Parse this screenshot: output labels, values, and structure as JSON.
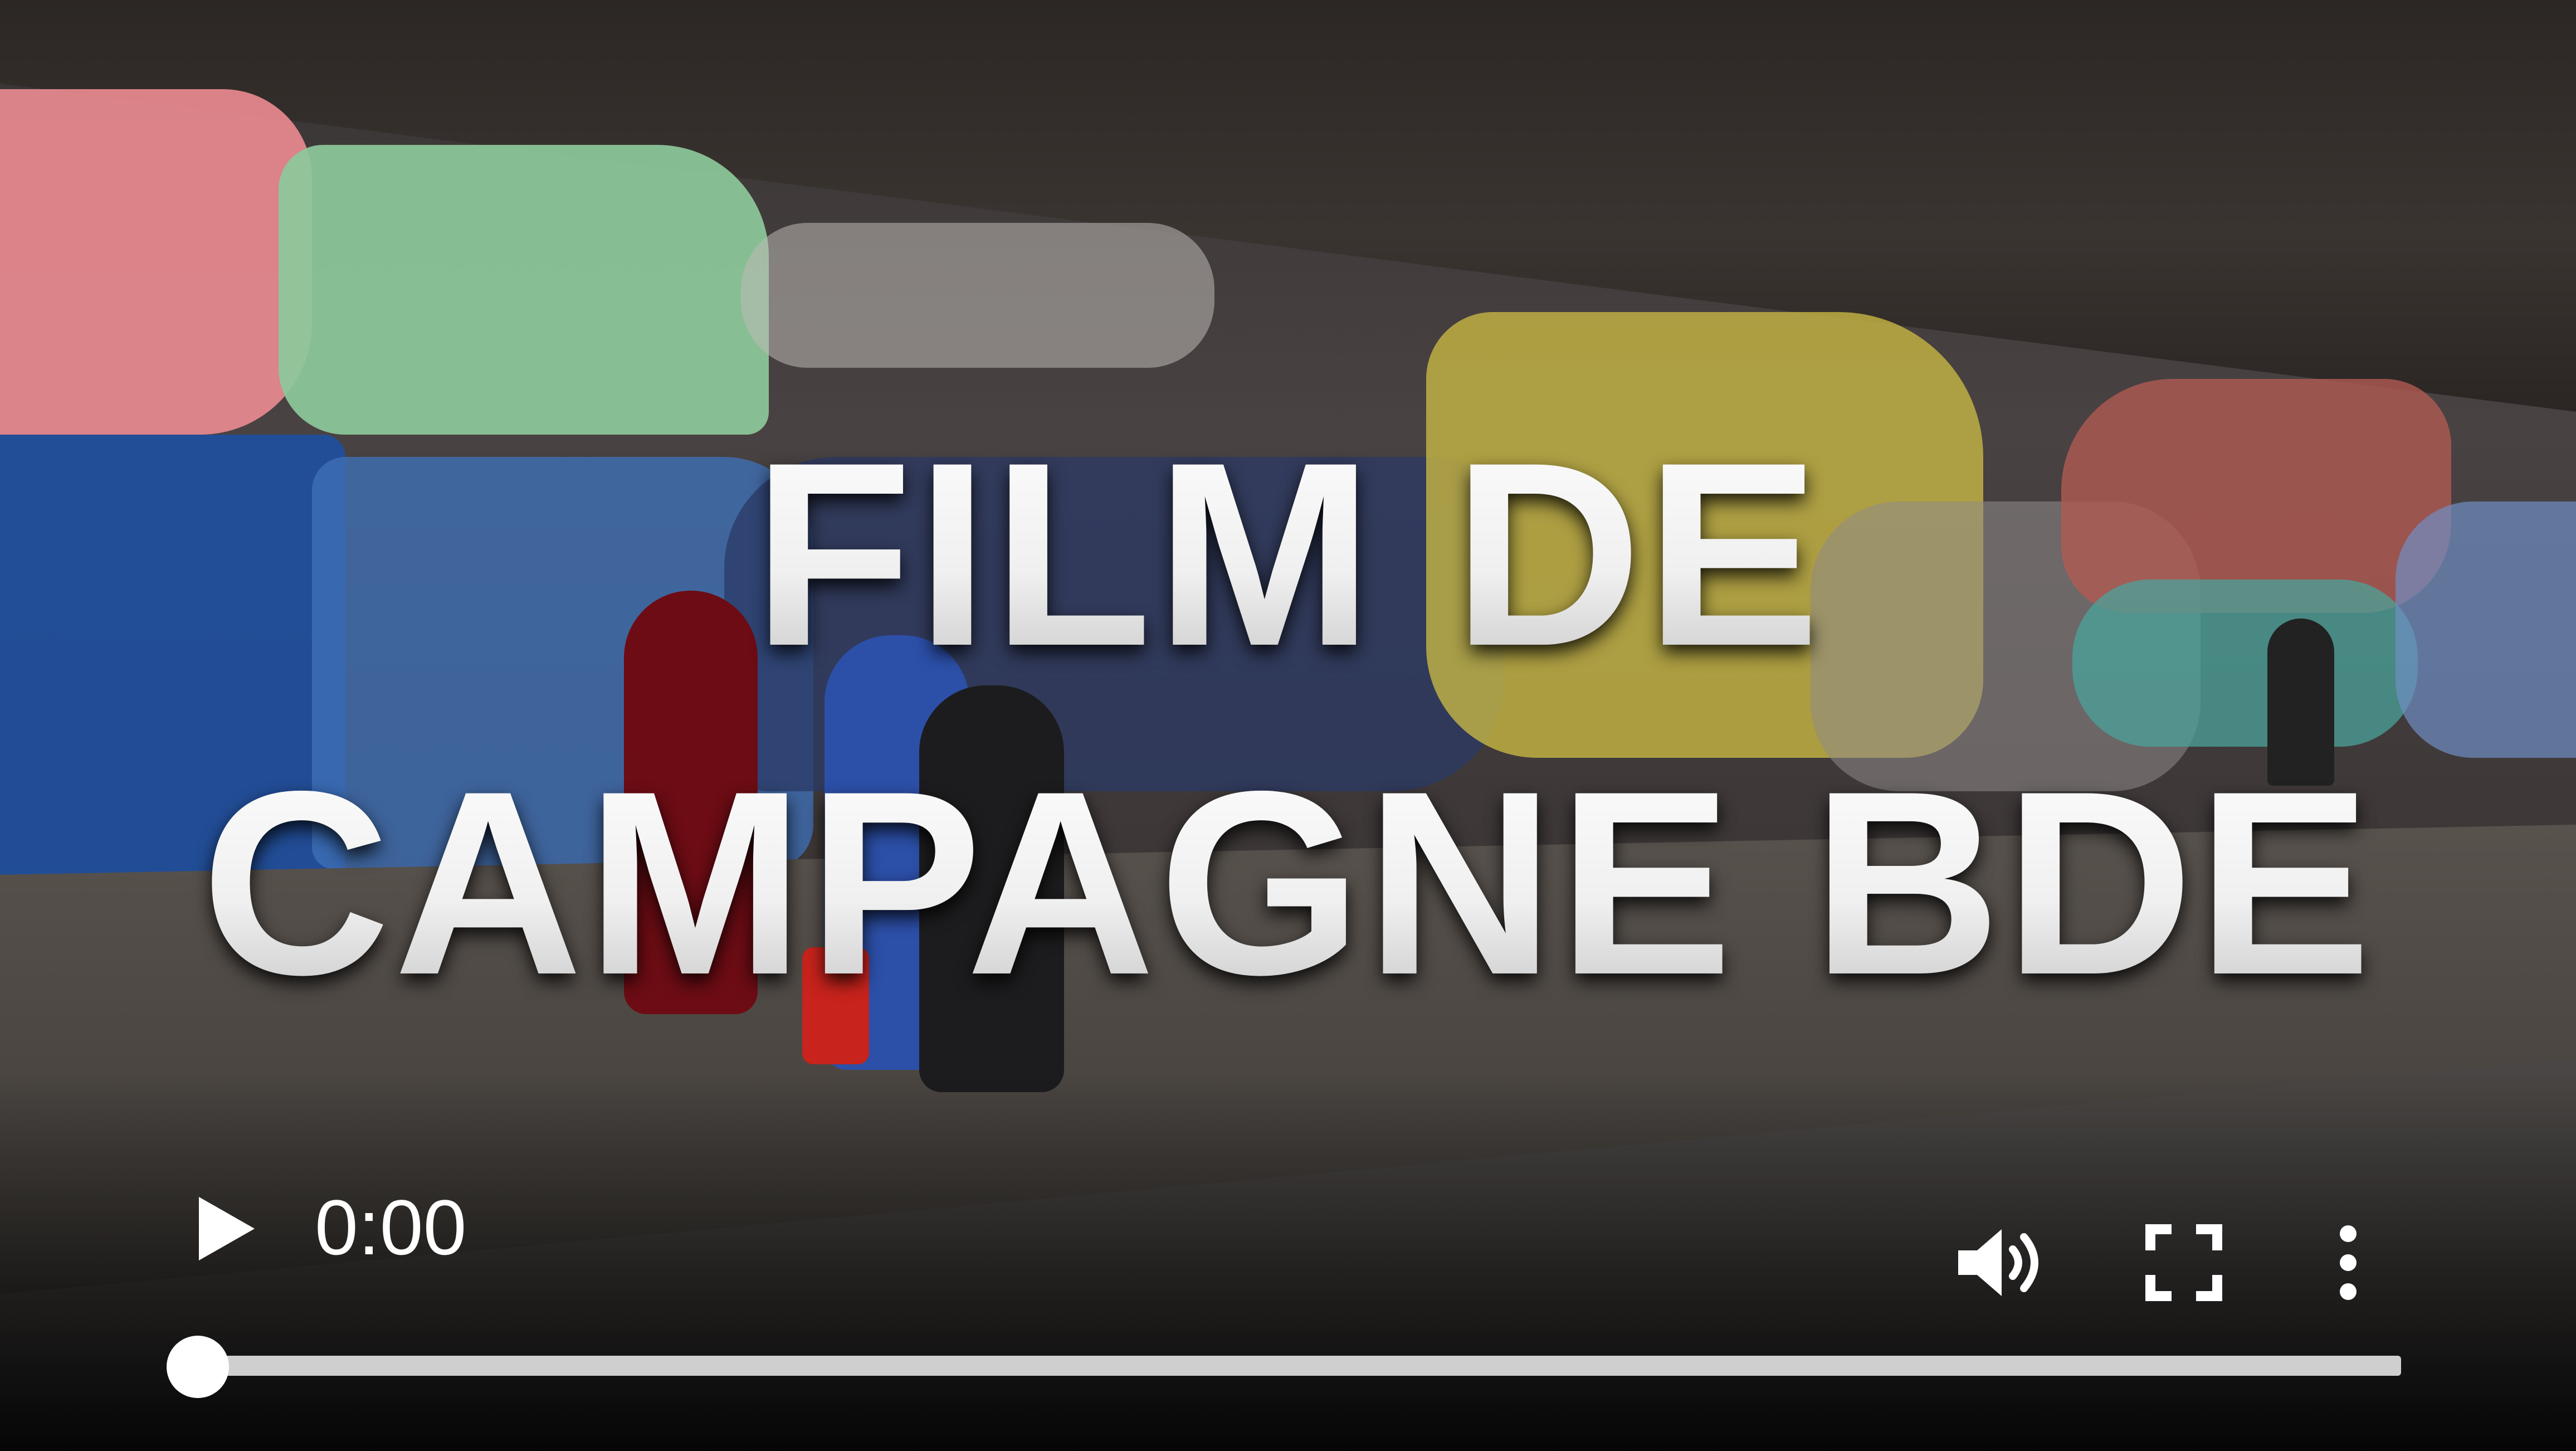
{
  "video": {
    "title_line_1": "FILM DE",
    "title_line_2": "CAMPAGNE BDE"
  },
  "controls": {
    "play_icon": "play-icon",
    "time_current": "0:00",
    "volume_icon": "volume-icon",
    "fullscreen_icon": "fullscreen-icon",
    "more_icon": "more-vertical-icon",
    "progress_fraction": 0
  },
  "colors": {
    "control_foreground": "#ffffff",
    "progress_track": "#cfcfcf"
  }
}
